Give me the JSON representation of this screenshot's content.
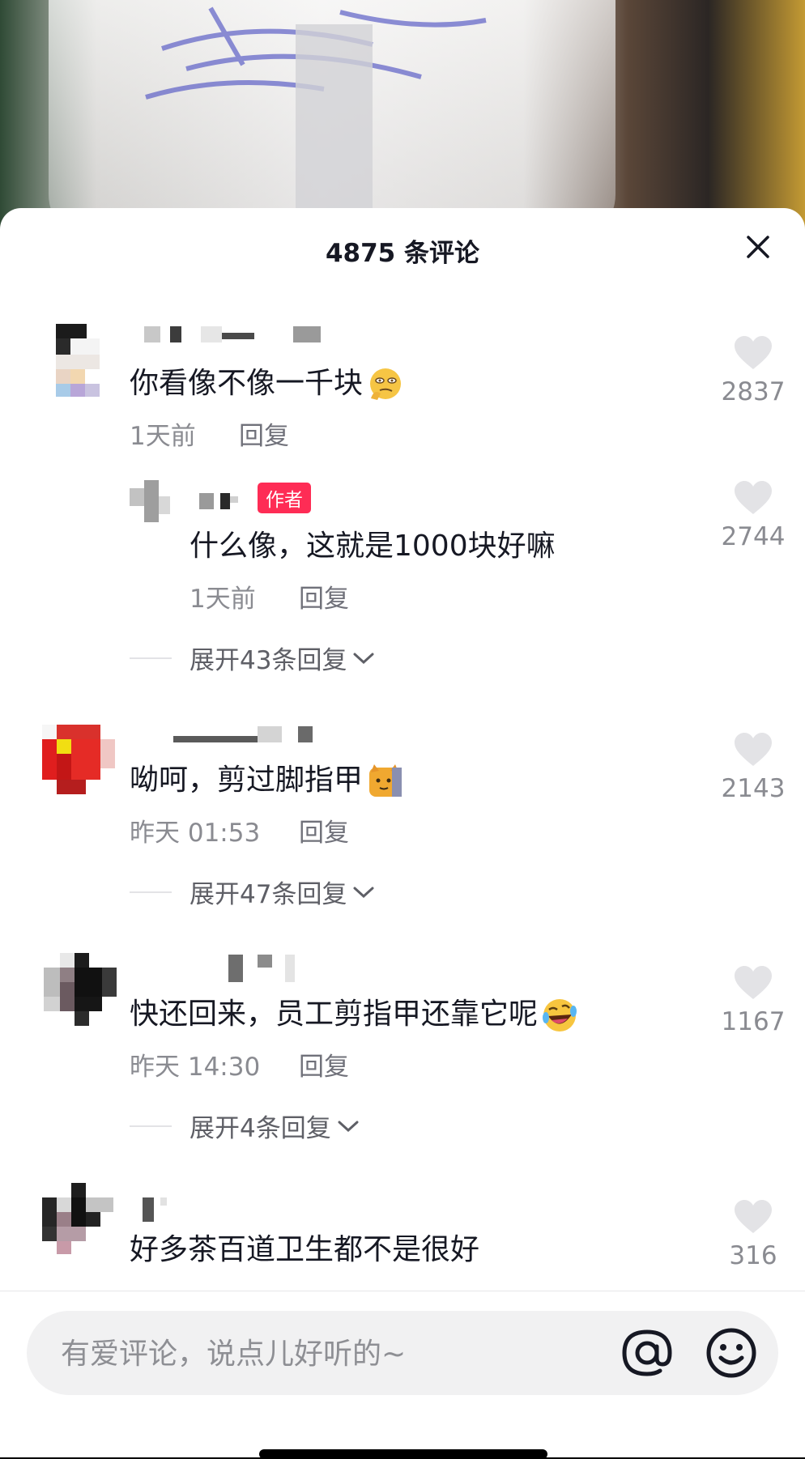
{
  "header": {
    "title": "4875 条评论",
    "close_icon": "close-icon"
  },
  "comments": [
    {
      "text": "你看像不像一千块",
      "emoji": "thinking-face-emoji",
      "time": "1天前",
      "reply_label": "回复",
      "likes": "2837",
      "replies": [
        {
          "badge": "作者",
          "text": "什么像，这就是1000块好嘛",
          "time": "1天前",
          "reply_label": "回复",
          "likes": "2744"
        }
      ],
      "expand": "展开43条回复"
    },
    {
      "text": "呦呵，剪过脚指甲",
      "emoji": "cat-face-emoji",
      "time": "昨天 01:53",
      "reply_label": "回复",
      "likes": "2143",
      "expand": "展开47条回复"
    },
    {
      "text": "快还回来，员工剪指甲还靠它呢",
      "emoji": "rolling-on-floor-laughing-emoji",
      "time": "昨天 14:30",
      "reply_label": "回复",
      "likes": "1167",
      "expand": "展开4条回复"
    },
    {
      "text": "好多茶百道卫生都不是很好",
      "likes": "316"
    }
  ],
  "input": {
    "placeholder": "有爱评论，说点儿好听的~"
  },
  "colors": {
    "author_badge": "#fe2c55",
    "text": "#161823",
    "meta": "#8a8b91"
  }
}
